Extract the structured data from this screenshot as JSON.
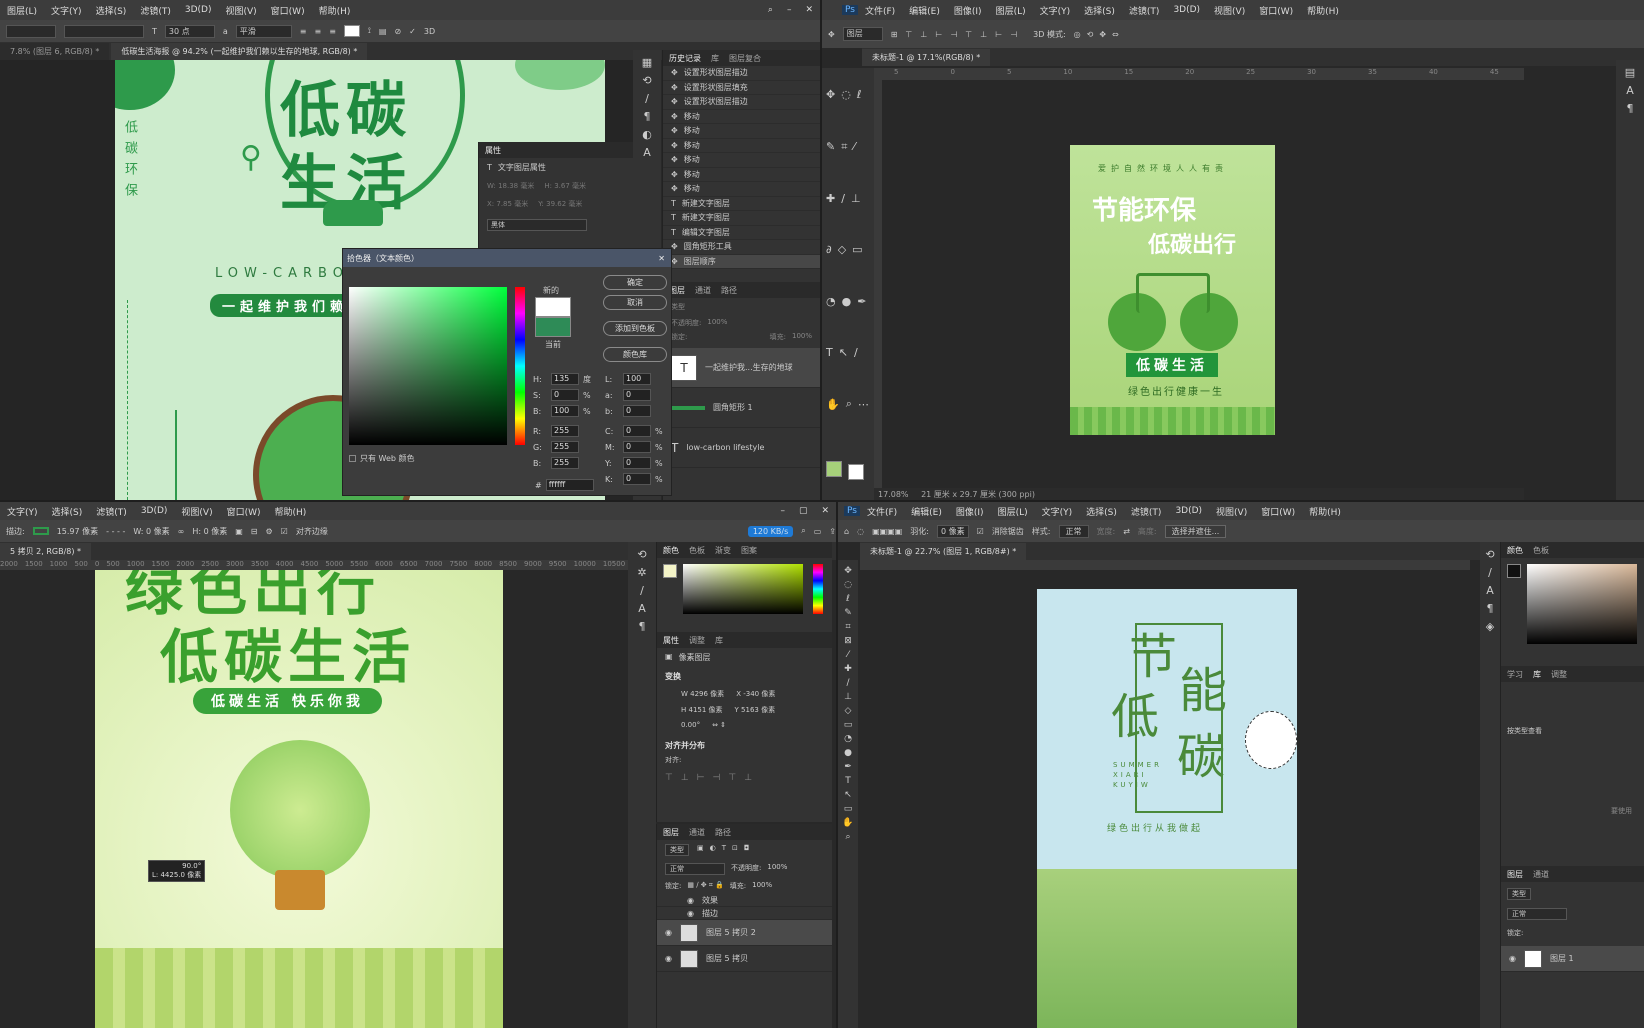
{
  "tl": {
    "menu": [
      "图层(L)",
      "文字(Y)",
      "选择(S)",
      "滤镜(T)",
      "3D(D)",
      "视图(V)",
      "窗口(W)",
      "帮助(H)"
    ],
    "opt_font_size": "30 点",
    "opt_aa": "平滑",
    "opt_3d": "3D",
    "tab_inactive": "7.8% (图层 6, RGB/8) *",
    "tab_active": "低碳生活海报 @ 94.2% (一起维护我们赖以生存的地球, RGB/8) *",
    "poster": {
      "title1": "低碳",
      "title2": "生活",
      "vertical": "低碳环保",
      "lowcarbon": "LOW-CARBON",
      "slogan": "一起维护我们赖"
    },
    "history": {
      "tabs": [
        "历史记录",
        "库",
        "图层复合"
      ],
      "items": [
        "设置形状图层描边",
        "设置形状图层填充",
        "设置形状图层描边",
        "移动",
        "移动",
        "移动",
        "移动",
        "移动",
        "移动",
        "新建文字图层",
        "新建文字图层",
        "编辑文字图层",
        "圆角矩形工具",
        "图层顺序"
      ]
    },
    "properties": {
      "title": "属性",
      "subtitle": "文字图层属性",
      "w": "W: 18.38 毫米",
      "h": "H: 3.67 毫米",
      "x": "X: 7.85 毫米",
      "y": "Y: 39.62 毫米",
      "font": "黑体"
    },
    "layers": {
      "tabs": [
        "图层",
        "通道",
        "路径"
      ],
      "kind": "类型",
      "opacity_label": "不透明度:",
      "opacity": "100%",
      "fill_label": "填充:",
      "fill": "100%",
      "lock_label": "锁定:",
      "items": [
        "一起维护我...生存的地球",
        "圆角矩形 1",
        "low-carbon lifestyle"
      ]
    },
    "color_picker": {
      "title": "拾色器（文本颜色）",
      "new_label": "新的",
      "current_label": "当前",
      "ok": "确定",
      "cancel": "取消",
      "add_swatch": "添加到色板",
      "color_lib": "颜色库",
      "web_only": "只有 Web 颜色",
      "fields_left": [
        {
          "label": "H:",
          "value": "135",
          "unit": "度"
        },
        {
          "label": "S:",
          "value": "0",
          "unit": "%"
        },
        {
          "label": "B:",
          "value": "100",
          "unit": "%"
        },
        {
          "label": "R:",
          "value": "255",
          "unit": ""
        },
        {
          "label": "G:",
          "value": "255",
          "unit": ""
        },
        {
          "label": "B:",
          "value": "255",
          "unit": ""
        }
      ],
      "fields_right": [
        {
          "label": "L:",
          "value": "100",
          "unit": ""
        },
        {
          "label": "a:",
          "value": "0",
          "unit": ""
        },
        {
          "label": "b:",
          "value": "0",
          "unit": ""
        },
        {
          "label": "C:",
          "value": "0",
          "unit": "%"
        },
        {
          "label": "M:",
          "value": "0",
          "unit": "%"
        },
        {
          "label": "Y:",
          "value": "0",
          "unit": "%"
        },
        {
          "label": "K:",
          "value": "0",
          "unit": "%"
        }
      ],
      "hex_label": "#",
      "hex": "ffffff",
      "new_color": "#ffffff",
      "current_color": "#2e8b57"
    }
  },
  "tr": {
    "menu": [
      "文件(F)",
      "编辑(E)",
      "图像(I)",
      "图层(L)",
      "文字(Y)",
      "选择(S)",
      "滤镜(T)",
      "3D(D)",
      "视图(V)",
      "窗口(W)",
      "帮助(H)"
    ],
    "opt_layer": "图层",
    "opt_3d": "3D 模式:",
    "tab": "未标题-1 @ 17.1%(RGB/8) *",
    "ruler_ticks": [
      "5",
      "0",
      "5",
      "10",
      "15",
      "20",
      "25",
      "30",
      "35",
      "40",
      "45"
    ],
    "poster": {
      "top": "爱护自然环境人人有责",
      "line1": "节能环保",
      "line2": "低碳出行",
      "badge": "低碳生活",
      "sub": "绿色出行健康一生"
    },
    "status_zoom": "17.08%",
    "status_size": "21 厘米 x 29.7 厘米 (300 ppi)"
  },
  "bl": {
    "menu": [
      "文字(Y)",
      "选择(S)",
      "滤镜(T)",
      "3D(D)",
      "视图(V)",
      "窗口(W)",
      "帮助(H)"
    ],
    "opt_stroke": "描边:",
    "opt_stroke_val": "15.97 像素",
    "opt_w": "W: 0 像素",
    "opt_h": "H: 0 像素",
    "opt_align": "对齐边缘",
    "speed": "120 KB/s",
    "tab": "5 拷贝 2, RGB/8) *",
    "ruler_ticks": [
      "2000",
      "1500",
      "1000",
      "500",
      "0",
      "500",
      "1000",
      "1500",
      "2000",
      "2500",
      "3000",
      "3500",
      "4000",
      "4500",
      "5000",
      "5500",
      "6000",
      "6500",
      "7000",
      "7500",
      "8000",
      "8500",
      "9000",
      "9500",
      "10000",
      "10500",
      "11000"
    ],
    "poster": {
      "title1": "绿色出行",
      "title2": "低碳生活",
      "banner": "低碳生活 快乐你我"
    },
    "tooltip1": "90.0°",
    "tooltip2": "L: 4425.0 像素",
    "color_tabs": [
      "颜色",
      "色板",
      "渐变",
      "图案"
    ],
    "props_tabs": [
      "属性",
      "调整",
      "库"
    ],
    "props_kind": "像素图层",
    "transform_label": "变换",
    "tw": "W 4296 像素",
    "tx": "X -340 像素",
    "th": "H 4151 像素",
    "ty": "Y 5163 像素",
    "angle": "0.00°",
    "align_label": "对齐并分布",
    "align_sub": "对齐:",
    "layers_tabs": [
      "图层",
      "通道",
      "路径"
    ],
    "kind": "类型",
    "mode": "正常",
    "opacity_label": "不透明度:",
    "opacity": "100%",
    "fill_label": "填充:",
    "fill": "100%",
    "lock_label": "锁定:",
    "effects": "效果",
    "stroke_fx": "描边",
    "layer1": "图层 5 拷贝 2",
    "layer2": "图层 5 拷贝"
  },
  "br": {
    "menu": [
      "文件(F)",
      "编辑(E)",
      "图像(I)",
      "图层(L)",
      "文字(Y)",
      "选择(S)",
      "滤镜(T)",
      "3D(D)",
      "视图(V)",
      "窗口(W)",
      "帮助(H)"
    ],
    "opt_feather": "羽化:",
    "opt_feather_val": "0 像素",
    "opt_antialias": "消除锯齿",
    "opt_style": "样式:",
    "opt_style_val": "正常",
    "opt_width": "宽度:",
    "opt_height": "高度:",
    "opt_select": "选择并遮住...",
    "tab": "未标题-1 @ 22.7% (图层 1, RGB/8#) *",
    "poster": {
      "ch1": "节",
      "ch2": "能",
      "ch3": "低",
      "ch4": "碳",
      "summer": "SUMMER",
      "xiari": "XIARI",
      "kuyiw": "KUYIW",
      "sub": "绿色出行从我做起"
    },
    "side_tabs": [
      "颜色",
      "色板"
    ],
    "side_tabs2": [
      "学习",
      "库",
      "调整"
    ],
    "layers_tabs": [
      "图层",
      "通道"
    ],
    "kind": "类型",
    "mode": "正常",
    "lock_label": "锁定:",
    "layer": "图层 1",
    "search_type": "按类型查看",
    "side_note": "要使用"
  }
}
